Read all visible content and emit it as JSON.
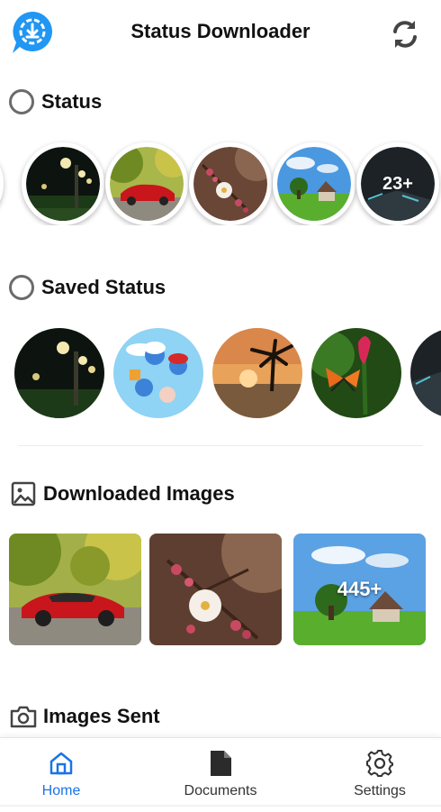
{
  "header": {
    "title": "Status Downloader",
    "logo_icon": "whatsapp-download-logo",
    "refresh_icon": "refresh-icon",
    "accent": "#1a73e8"
  },
  "sections": {
    "status": {
      "label": "Status",
      "icon": "circle-outline-icon"
    },
    "saved": {
      "label": "Saved Status",
      "icon": "circle-outline-icon"
    },
    "images": {
      "label": "Downloaded Images",
      "icon": "image-icon"
    },
    "sent": {
      "label": "Images Sent",
      "icon": "camera-icon"
    }
  },
  "status_row": {
    "items": [
      "night-street",
      "red-car",
      "blossom",
      "house-field"
    ],
    "more_count": "23+"
  },
  "saved_row": {
    "items": [
      "night-street",
      "smurfs",
      "sunset-palm",
      "butterfly",
      "dark-tech"
    ]
  },
  "images_row": {
    "items": [
      "red-car",
      "blossom",
      "house-field"
    ],
    "more_count": "445+"
  },
  "nav": {
    "home": {
      "label": "Home",
      "icon": "home-icon",
      "active": true
    },
    "documents": {
      "label": "Documents",
      "icon": "document-icon",
      "active": false
    },
    "settings": {
      "label": "Settings",
      "icon": "gear-icon",
      "active": false
    }
  }
}
